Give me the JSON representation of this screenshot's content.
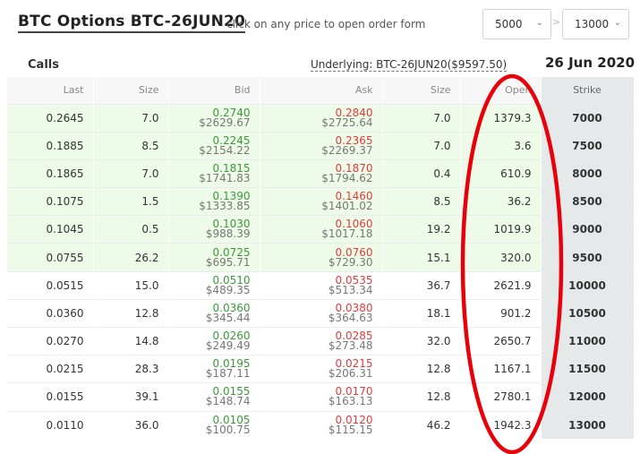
{
  "header": {
    "title": "BTC Options BTC-26JUN20",
    "hint": "click on any price to open order form",
    "strike_min": "5000",
    "strike_max": "13000",
    "separator": ">"
  },
  "subheader": {
    "calls_label": "Calls",
    "underlying": "Underlying: BTC-26JUN20($9597.50)",
    "expiry": "26 Jun 2020"
  },
  "columns": [
    "Last",
    "Size",
    "Bid",
    "Ask",
    "Size",
    "Open",
    "Strike"
  ],
  "rows": [
    {
      "last": "0.2645",
      "size1": "7.0",
      "bid": "0.2740",
      "bid_usd": "$2629.67",
      "ask": "0.2840",
      "ask_usd": "$2725.64",
      "size2": "7.0",
      "open": "1379.3",
      "strike": "7000",
      "itm": true
    },
    {
      "last": "0.1885",
      "size1": "8.5",
      "bid": "0.2245",
      "bid_usd": "$2154.22",
      "ask": "0.2365",
      "ask_usd": "$2269.37",
      "size2": "7.0",
      "open": "3.6",
      "strike": "7500",
      "itm": true
    },
    {
      "last": "0.1865",
      "size1": "7.0",
      "bid": "0.1815",
      "bid_usd": "$1741.83",
      "ask": "0.1870",
      "ask_usd": "$1794.62",
      "size2": "0.4",
      "open": "610.9",
      "strike": "8000",
      "itm": true
    },
    {
      "last": "0.1075",
      "size1": "1.5",
      "bid": "0.1390",
      "bid_usd": "$1333.85",
      "ask": "0.1460",
      "ask_usd": "$1401.02",
      "size2": "8.5",
      "open": "36.2",
      "strike": "8500",
      "itm": true
    },
    {
      "last": "0.1045",
      "size1": "0.5",
      "bid": "0.1030",
      "bid_usd": "$988.39",
      "ask": "0.1060",
      "ask_usd": "$1017.18",
      "size2": "19.2",
      "open": "1019.9",
      "strike": "9000",
      "itm": true
    },
    {
      "last": "0.0755",
      "size1": "26.2",
      "bid": "0.0725",
      "bid_usd": "$695.71",
      "ask": "0.0760",
      "ask_usd": "$729.30",
      "size2": "15.1",
      "open": "320.0",
      "strike": "9500",
      "itm": true
    },
    {
      "last": "0.0515",
      "size1": "15.0",
      "bid": "0.0510",
      "bid_usd": "$489.35",
      "ask": "0.0535",
      "ask_usd": "$513.34",
      "size2": "36.7",
      "open": "2621.9",
      "strike": "10000",
      "itm": false
    },
    {
      "last": "0.0360",
      "size1": "12.8",
      "bid": "0.0360",
      "bid_usd": "$345.44",
      "ask": "0.0380",
      "ask_usd": "$364.63",
      "size2": "18.1",
      "open": "901.2",
      "strike": "10500",
      "itm": false
    },
    {
      "last": "0.0270",
      "size1": "14.8",
      "bid": "0.0260",
      "bid_usd": "$249.49",
      "ask": "0.0285",
      "ask_usd": "$273.48",
      "size2": "32.0",
      "open": "2650.7",
      "strike": "11000",
      "itm": false
    },
    {
      "last": "0.0215",
      "size1": "28.3",
      "bid": "0.0195",
      "bid_usd": "$187.11",
      "ask": "0.0215",
      "ask_usd": "$206.31",
      "size2": "12.8",
      "open": "1167.1",
      "strike": "11500",
      "itm": false
    },
    {
      "last": "0.0155",
      "size1": "39.1",
      "bid": "0.0155",
      "bid_usd": "$148.74",
      "ask": "0.0170",
      "ask_usd": "$163.13",
      "size2": "12.8",
      "open": "2780.1",
      "strike": "12000",
      "itm": false
    },
    {
      "last": "0.0110",
      "size1": "36.0",
      "bid": "0.0105",
      "bid_usd": "$100.75",
      "ask": "0.0120",
      "ask_usd": "$115.15",
      "size2": "46.2",
      "open": "1942.3",
      "strike": "13000",
      "itm": false
    }
  ],
  "colors": {
    "bid": "#3a9a3a",
    "ask": "#e23b3b",
    "itm_row": "#eefbe8",
    "strike_col": "#e6e9ea",
    "annotation": "#e8000b"
  }
}
